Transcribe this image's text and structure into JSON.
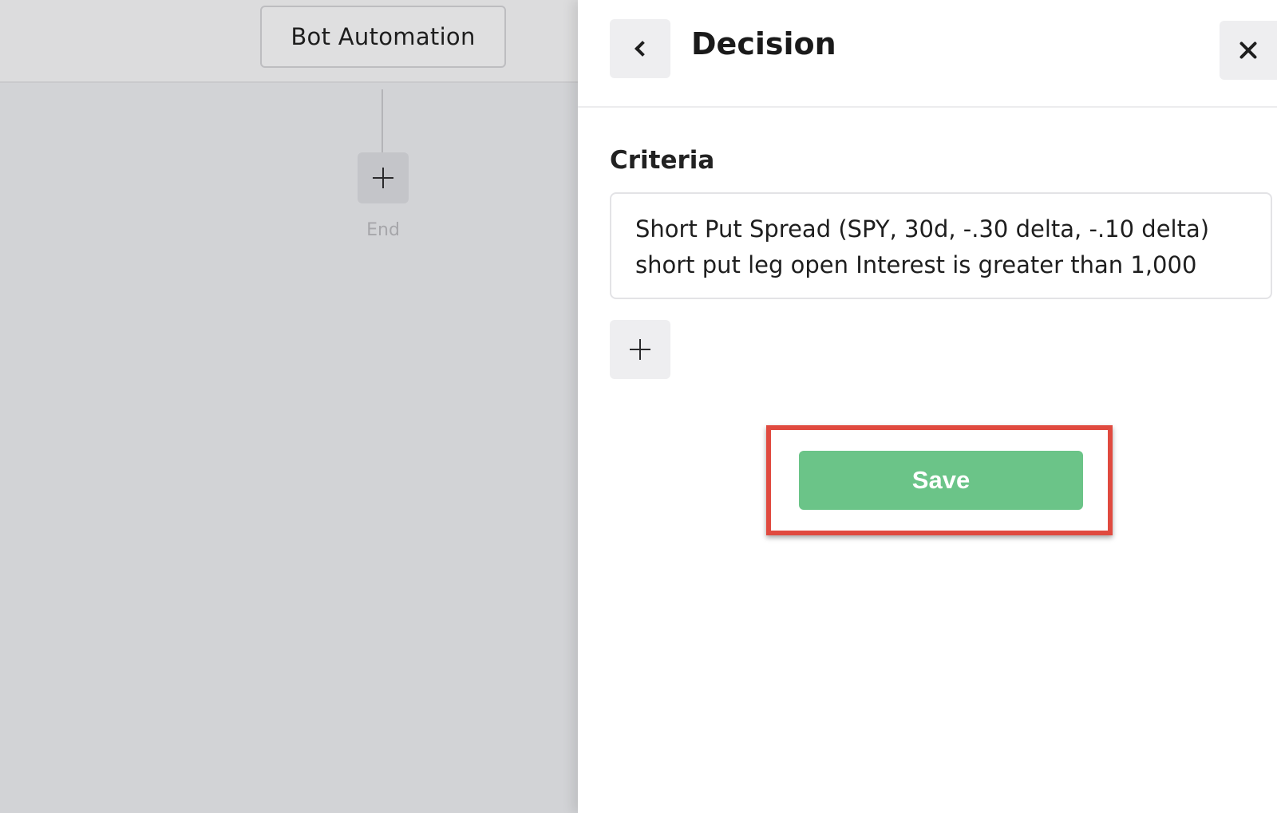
{
  "canvas": {
    "trigger_node_label": "Bot Automation",
    "end_label": "End",
    "add_node_icon": "plus-icon"
  },
  "panel": {
    "title": "Decision",
    "back_icon": "chevron-left-icon",
    "close_icon": "close-icon",
    "criteria_label": "Criteria",
    "criteria_lines": [
      "Short Put Spread (SPY, 30d, -.30 delta, -.10 delta)",
      "short put leg open Interest is greater than 1,000"
    ],
    "add_criteria_icon": "plus-icon",
    "save_label": "Save"
  },
  "colors": {
    "save_button": "#6bc488",
    "highlight_border": "#e04a3f",
    "overlay": "#d2d3d6"
  }
}
